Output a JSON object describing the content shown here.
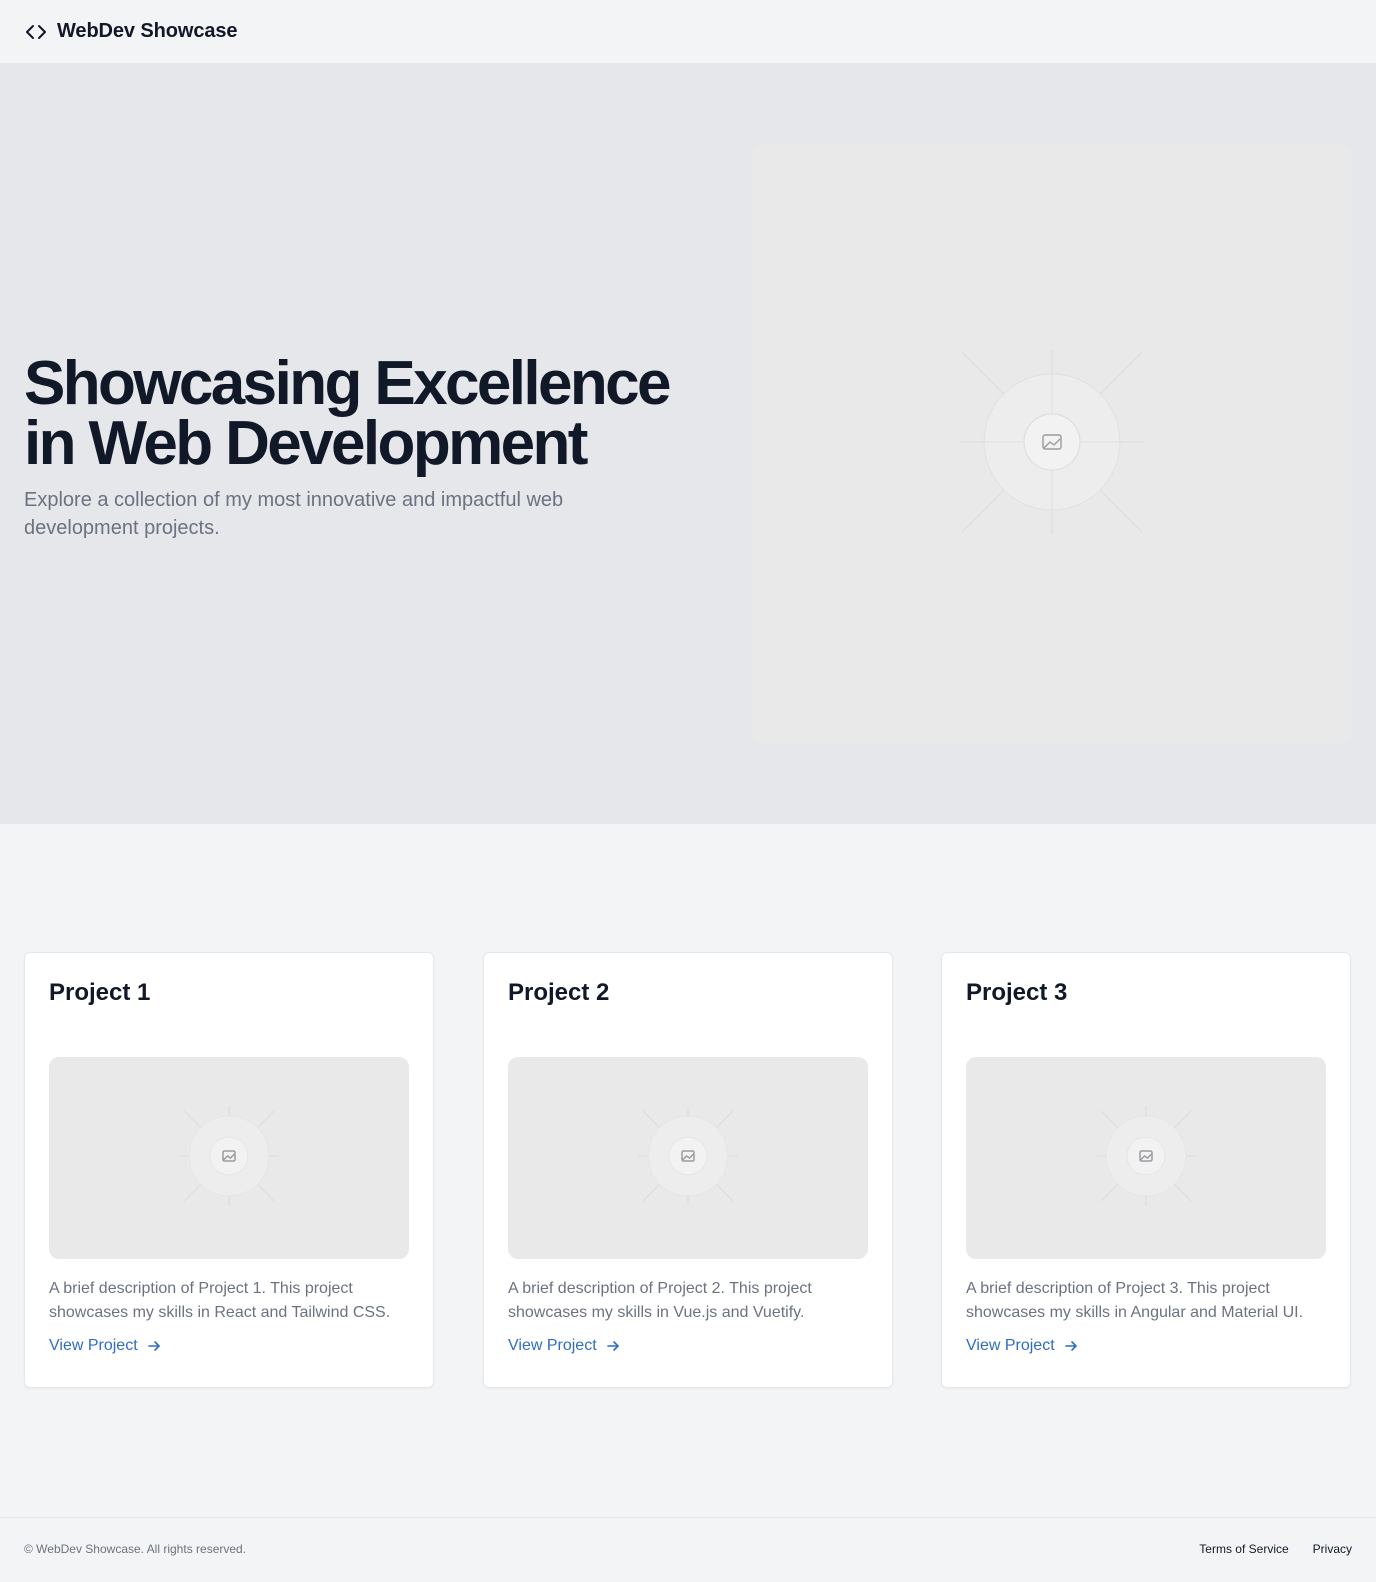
{
  "header": {
    "brand_name": "WebDev Showcase",
    "brand_icon": "code-icon"
  },
  "hero": {
    "title_line1": "Showcasing Excellence",
    "title_line2": "in Web Development",
    "subtitle": "Explore a collection of my most innovative and impactful web development projects.",
    "image_icon": "image-placeholder-icon"
  },
  "projects": [
    {
      "title": "Project 1",
      "description": "A brief description of Project 1. This project showcases my skills in React and Tailwind CSS.",
      "link_label": "View Project"
    },
    {
      "title": "Project 2",
      "description": "A brief description of Project 2. This project showcases my skills in Vue.js and Vuetify.",
      "link_label": "View Project"
    },
    {
      "title": "Project 3",
      "description": "A brief description of Project 3. This project showcases my skills in Angular and Material UI.",
      "link_label": "View Project"
    }
  ],
  "footer": {
    "copyright": "© WebDev Showcase. All rights reserved.",
    "links": [
      "Terms of Service",
      "Privacy"
    ]
  },
  "colors": {
    "page_bg": "#f3f4f6",
    "hero_bg": "#e5e7eb",
    "heading": "#111827",
    "muted_text": "#6b7280",
    "link": "#2f6dc4"
  }
}
